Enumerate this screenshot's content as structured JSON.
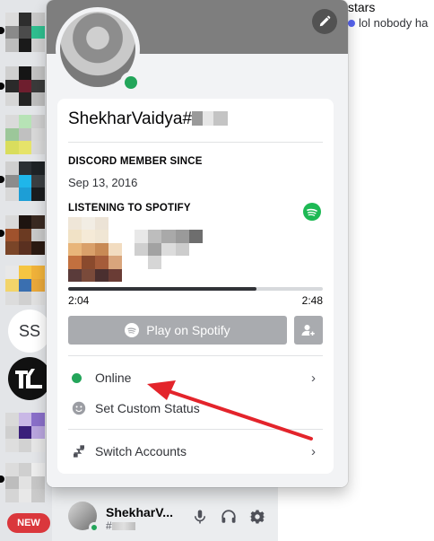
{
  "chat_peek": {
    "channel_fragment": "stars",
    "message_fragment": "lol nobody ha"
  },
  "rail": {
    "servers": [
      {
        "id": "ss",
        "label": "SS"
      },
      {
        "id": "tl",
        "label": "TL"
      }
    ],
    "new_badge": "NEW"
  },
  "profile": {
    "display_name": "ShekharVaidya#",
    "sections": {
      "member_since_heading": "DISCORD MEMBER SINCE",
      "member_since_value": "Sep 13, 2016",
      "listening_heading": "LISTENING TO SPOTIFY"
    },
    "playback": {
      "elapsed": "2:04",
      "total": "2:48",
      "progress": 0.74
    },
    "play_button_label": "Play on Spotify",
    "menu": {
      "online": "Online",
      "custom_status": "Set Custom Status",
      "switch_accounts": "Switch Accounts"
    }
  },
  "user_bar": {
    "name": "ShekharV...",
    "tag": "#"
  },
  "colors": {
    "online": "#23a55a",
    "spotify": "#1db954",
    "annotation_arrow": "#e3242b",
    "new_badge": "#da373c"
  }
}
